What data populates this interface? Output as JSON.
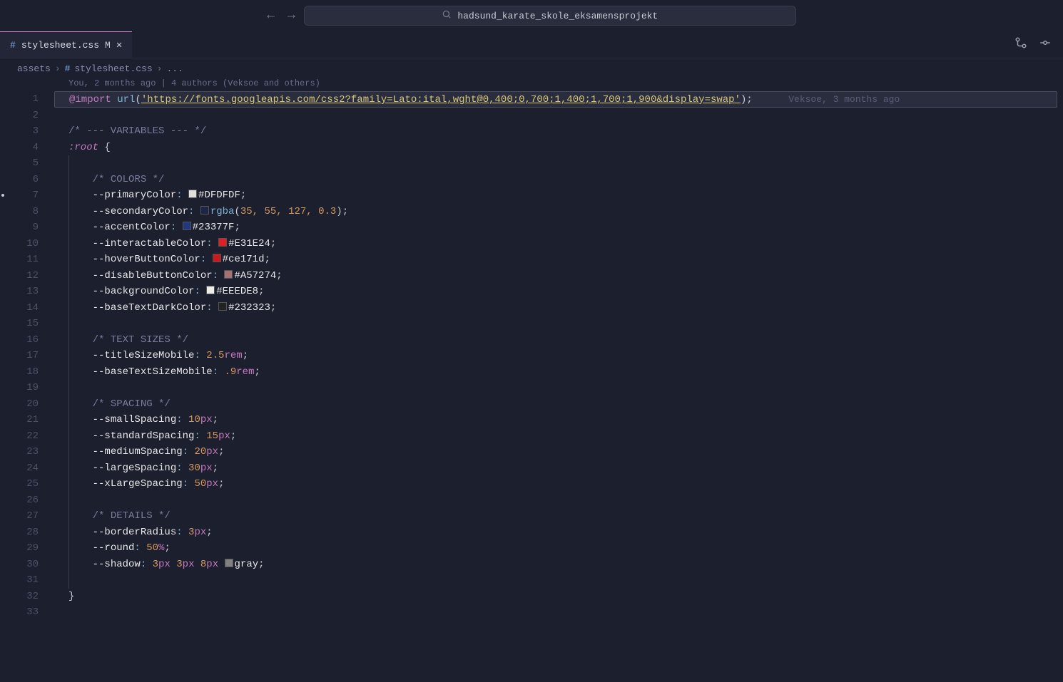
{
  "titlebar": {
    "search_text": "hadsund_karate_skole_eksamensprojekt"
  },
  "tab": {
    "filename": "stylesheet.css",
    "modified_marker": "M"
  },
  "breadcrumb": {
    "folder": "assets",
    "file": "stylesheet.css",
    "tail": "..."
  },
  "blame_header": "You, 2 months ago | 4 authors (Veksoe and others)",
  "inline_blame": "Veksoe, 3 months ago",
  "code": {
    "l1": {
      "atrule": "@import",
      "func": "url",
      "paren_open": "(",
      "str": "'https://fonts.googleapis.com/css2?family=Lato:ital,wght@0,400;0,700;1,400;1,700;1,900&display=swap'",
      "paren_close": ")",
      "semi": ";"
    },
    "l3": "/* --- VARIABLES --- */",
    "l4_sel": ":root",
    "l4_brace": " {",
    "l6": "/* COLORS */",
    "l7_prop": "--primaryColor",
    "l7_val": "#DFDFDF",
    "l8_prop": "--secondaryColor",
    "l8_rgba": "rgba",
    "l8_args": "35, 55, 127, 0.3",
    "l9_prop": "--accentColor",
    "l9_val": "#23377F",
    "l10_prop": "--interactableColor",
    "l10_val": "#E31E24",
    "l11_prop": "--hoverButtonColor",
    "l11_val": "#ce171d",
    "l12_prop": "--disableButtonColor",
    "l12_val": "#A57274",
    "l13_prop": "--backgroundColor",
    "l13_val": "#EEEDE8",
    "l14_prop": "--baseTextDarkColor",
    "l14_val": "#232323",
    "l16": "/* TEXT SIZES */",
    "l17_prop": "--titleSizeMobile",
    "l17_num": "2.5",
    "l17_unit": "rem",
    "l18_prop": "--baseTextSizeMobile",
    "l18_num": ".9",
    "l18_unit": "rem",
    "l20": "/* SPACING */",
    "l21_prop": "--smallSpacing",
    "l21_num": "10",
    "l21_unit": "px",
    "l22_prop": "--standardSpacing",
    "l22_num": "15",
    "l22_unit": "px",
    "l23_prop": "--mediumSpacing",
    "l23_num": "20",
    "l23_unit": "px",
    "l24_prop": "--largeSpacing",
    "l24_num": "30",
    "l24_unit": "px",
    "l25_prop": "--xLargeSpacing",
    "l25_num": "50",
    "l25_unit": "px",
    "l27": "/* DETAILS */",
    "l28_prop": "--borderRadius",
    "l28_num": "3",
    "l28_unit": "px",
    "l29_prop": "--round",
    "l29_num": "50",
    "l29_unit": "%",
    "l30_prop": "--shadow",
    "l30_a": "3",
    "l30_b": "3",
    "l30_c": "8",
    "l30_px": "px",
    "l30_color": "gray",
    "l32_brace": "}"
  },
  "swatches": {
    "l7": "#DFDFDF",
    "l8": "rgba(35,55,127,0.3)",
    "l9": "#23377F",
    "l10": "#E31E24",
    "l11": "#ce171d",
    "l12": "#A57274",
    "l13": "#EEEDE8",
    "l14": "#232323",
    "l30": "gray"
  }
}
